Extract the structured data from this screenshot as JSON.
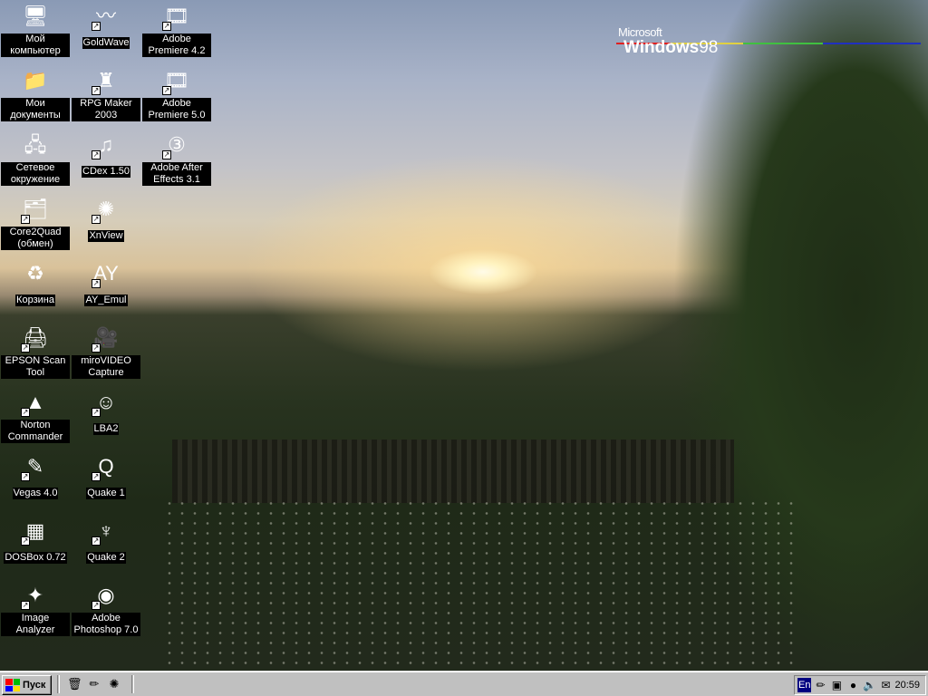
{
  "logo": {
    "microsoft": "Microsoft",
    "windows": "Windows",
    "version": "98"
  },
  "icons": [
    {
      "label": "Мой компьютер",
      "icon": "my-computer",
      "glyph": "🖥",
      "shortcut": false
    },
    {
      "label": "Мои документы",
      "icon": "folder",
      "glyph": "📁",
      "shortcut": false
    },
    {
      "label": "Сетевое окружение",
      "icon": "network",
      "glyph": "🖧",
      "shortcut": false
    },
    {
      "label": "Core2Quad (обмен)",
      "icon": "network-share",
      "glyph": "🗂",
      "shortcut": true
    },
    {
      "label": "Корзина",
      "icon": "recycle-bin",
      "glyph": "♻",
      "shortcut": false
    },
    {
      "label": "EPSON Scan Tool",
      "icon": "scanner",
      "glyph": "🖨",
      "shortcut": true
    },
    {
      "label": "Norton Commander",
      "icon": "norton",
      "glyph": "▲",
      "shortcut": true
    },
    {
      "label": "Vegas 4.0",
      "icon": "vegas",
      "glyph": "✎",
      "shortcut": true
    },
    {
      "label": "DOSBox 0.72",
      "icon": "dosbox",
      "glyph": "▦",
      "shortcut": true
    },
    {
      "label": "Image Analyzer",
      "icon": "star",
      "glyph": "✦",
      "shortcut": true
    },
    {
      "label": "GoldWave",
      "icon": "goldwave",
      "glyph": "〰",
      "shortcut": true
    },
    {
      "label": "RPG Maker 2003",
      "icon": "castle",
      "glyph": "♜",
      "shortcut": true
    },
    {
      "label": "CDex 1.50",
      "icon": "cdex",
      "glyph": "♫",
      "shortcut": true
    },
    {
      "label": "XnView",
      "icon": "xnview",
      "glyph": "✺",
      "shortcut": true
    },
    {
      "label": "AY_Emul",
      "icon": "ay-emul",
      "glyph": "AY",
      "shortcut": true
    },
    {
      "label": "miroVIDEO Capture",
      "icon": "video-capture",
      "glyph": "🎥",
      "shortcut": true
    },
    {
      "label": "LBA2",
      "icon": "person",
      "glyph": "☺",
      "shortcut": true
    },
    {
      "label": "Quake 1",
      "icon": "quake",
      "glyph": "Q",
      "shortcut": true
    },
    {
      "label": "Quake 2",
      "icon": "quake2",
      "glyph": "♆",
      "shortcut": true
    },
    {
      "label": "Adobe Photoshop 7.0",
      "icon": "photoshop",
      "glyph": "◉",
      "shortcut": true
    },
    {
      "label": "Adobe Premiere 4.2",
      "icon": "film",
      "glyph": "🎞",
      "shortcut": true
    },
    {
      "label": "Adobe Premiere 5.0",
      "icon": "film",
      "glyph": "🎞",
      "shortcut": true
    },
    {
      "label": "Adobe After Effects 3.1",
      "icon": "after-effects",
      "glyph": "③",
      "shortcut": true
    }
  ],
  "taskbar": {
    "start_label": "Пуск",
    "quick_launch": [
      {
        "icon": "desktop",
        "glyph": "🗑"
      },
      {
        "icon": "pencil",
        "glyph": "✏"
      },
      {
        "icon": "xnview",
        "glyph": "✺"
      }
    ],
    "tray": {
      "language": "En",
      "icons": [
        {
          "icon": "pencil",
          "glyph": "✏"
        },
        {
          "icon": "display",
          "glyph": "▣"
        },
        {
          "icon": "red-ball",
          "glyph": "●"
        },
        {
          "icon": "volume",
          "glyph": "🔈"
        },
        {
          "icon": "scheduler",
          "glyph": "✉"
        }
      ],
      "clock": "20:59"
    }
  },
  "colors": {
    "flag": [
      "#ff0000",
      "#00b000",
      "#0000ff",
      "#ffd000"
    ]
  }
}
